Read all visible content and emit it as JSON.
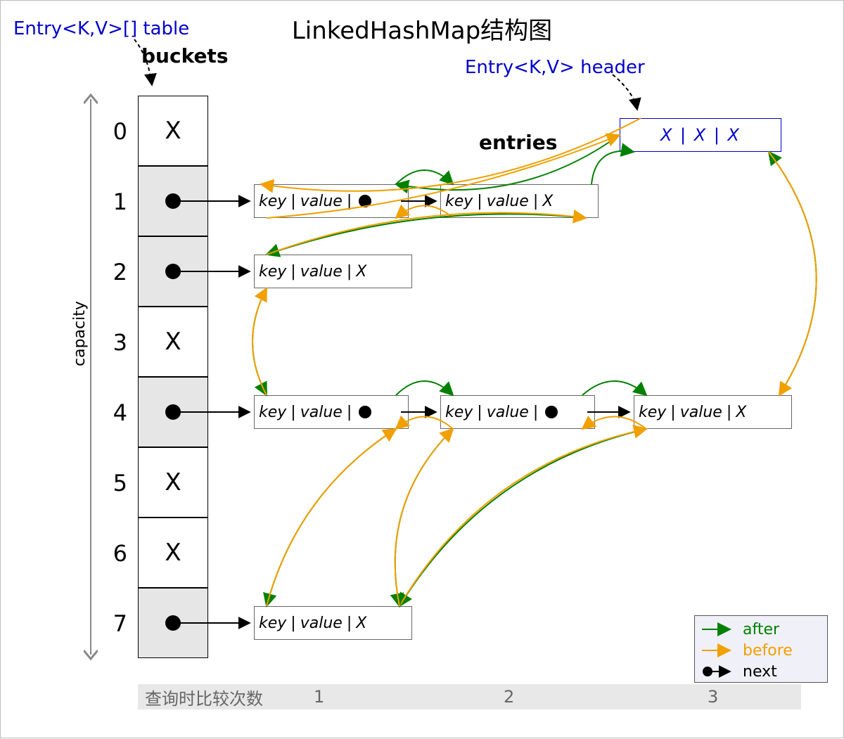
{
  "title": "LinkedHashMap结构图",
  "labels": {
    "table": "Entry<K,V>[] table",
    "header": "Entry<K,V> header",
    "buckets": "buckets",
    "entries": "entries",
    "capacity": "capacity",
    "header_cell": "X  |  X  | X"
  },
  "buckets": {
    "count": 8,
    "indices": [
      "0",
      "1",
      "2",
      "3",
      "4",
      "5",
      "6",
      "7"
    ],
    "cells": [
      {
        "type": "x"
      },
      {
        "type": "dot",
        "shade": true
      },
      {
        "type": "dot",
        "shade": true
      },
      {
        "type": "x"
      },
      {
        "type": "dot",
        "shade": true
      },
      {
        "type": "x"
      },
      {
        "type": "x"
      },
      {
        "type": "dot",
        "shade": true
      }
    ]
  },
  "entry_label": {
    "key": "key",
    "value": "value",
    "x": "X",
    "sep": " | "
  },
  "entries": [
    {
      "id": "e1a",
      "row": 1,
      "col": 1,
      "next": "dot"
    },
    {
      "id": "e1b",
      "row": 1,
      "col": 2,
      "next": "x"
    },
    {
      "id": "e2a",
      "row": 2,
      "col": 1,
      "next": "x"
    },
    {
      "id": "e4a",
      "row": 4,
      "col": 1,
      "next": "dot"
    },
    {
      "id": "e4b",
      "row": 4,
      "col": 2,
      "next": "dot"
    },
    {
      "id": "e4c",
      "row": 4,
      "col": 3,
      "next": "x"
    },
    {
      "id": "e7a",
      "row": 7,
      "col": 1,
      "next": "x"
    }
  ],
  "legend": {
    "after": "after",
    "before": "before",
    "next": "next"
  },
  "footer": {
    "label": "查询时比较次数",
    "cols": [
      "1",
      "2",
      "3"
    ]
  }
}
